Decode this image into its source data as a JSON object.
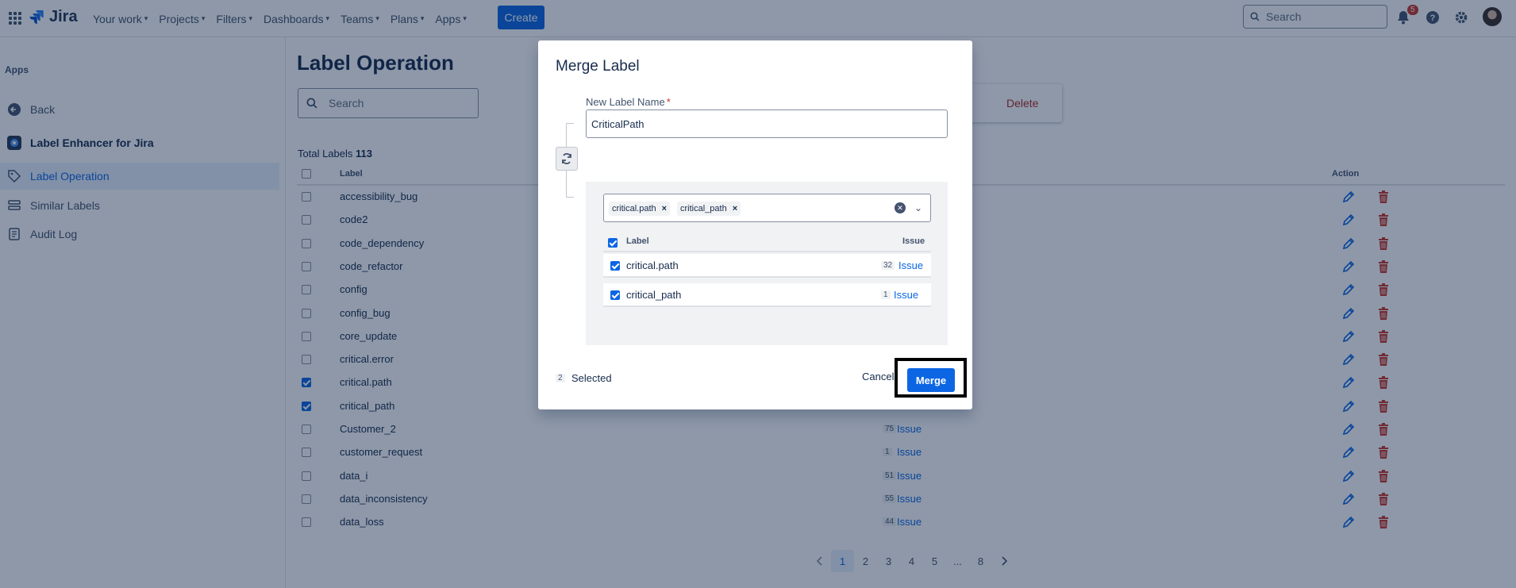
{
  "nav": {
    "logo_text": "Jira",
    "items": [
      {
        "label": "Your work"
      },
      {
        "label": "Projects"
      },
      {
        "label": "Filters"
      },
      {
        "label": "Dashboards"
      },
      {
        "label": "Teams"
      },
      {
        "label": "Plans"
      },
      {
        "label": "Apps"
      }
    ],
    "create_label": "Create",
    "search_placeholder": "Search",
    "notification_count": "5"
  },
  "sidebar": {
    "section_title": "Apps",
    "items": [
      {
        "label": "Back",
        "icon": "arrow-left-icon"
      },
      {
        "label": "Label Enhancer for Jira",
        "icon": "app-logo-icon"
      },
      {
        "label": "Label Operation",
        "icon": "tag-icon",
        "active": true
      },
      {
        "label": "Similar Labels",
        "icon": "stack-icon"
      },
      {
        "label": "Audit Log",
        "icon": "log-icon"
      }
    ]
  },
  "main": {
    "title": "Label Operation",
    "search_placeholder": "Search",
    "delete_label": "Delete",
    "total_label": "Total Labels",
    "total_count": "113",
    "columns": {
      "label": "Label",
      "action": "Action"
    },
    "rows": [
      {
        "name": "accessibility_bug",
        "checked": false
      },
      {
        "name": "code2",
        "checked": false
      },
      {
        "name": "code_dependency",
        "checked": false
      },
      {
        "name": "code_refactor",
        "checked": false
      },
      {
        "name": "config",
        "checked": false
      },
      {
        "name": "config_bug",
        "checked": false
      },
      {
        "name": "core_update",
        "checked": false
      },
      {
        "name": "critical.error",
        "checked": false
      },
      {
        "name": "critical.path",
        "checked": true
      },
      {
        "name": "critical_path",
        "checked": true
      },
      {
        "name": "Customer_2",
        "checked": false,
        "count": "75",
        "issue": "Issue"
      },
      {
        "name": "customer_request",
        "checked": false,
        "count": "1",
        "issue": "Issue"
      },
      {
        "name": "data_i",
        "checked": false,
        "count": "51",
        "issue": "Issue"
      },
      {
        "name": "data_inconsistency",
        "checked": false,
        "count": "55",
        "issue": "Issue"
      },
      {
        "name": "data_loss",
        "checked": false,
        "count": "44",
        "issue": "Issue"
      }
    ],
    "pagination": [
      "1",
      "2",
      "3",
      "4",
      "5",
      "...",
      "8"
    ],
    "current_page": "1"
  },
  "modal": {
    "title": "Merge Label",
    "field_label": "New Label Name",
    "required_mark": "*",
    "new_name_value": "CriticalPath",
    "tags": [
      "critical.path",
      "critical_path"
    ],
    "columns": {
      "label": "Label",
      "issue": "Issue"
    },
    "rows": [
      {
        "name": "critical.path",
        "count": "32",
        "issue": "Issue"
      },
      {
        "name": "critical_path",
        "count": "1",
        "issue": "Issue"
      }
    ],
    "selected_count": "2",
    "selected_label": "Selected",
    "cancel_label": "Cancel",
    "merge_label": "Merge"
  },
  "colors": {
    "brand": "#0c66e4",
    "danger": "#c9372c",
    "overlay": "#091e42"
  }
}
